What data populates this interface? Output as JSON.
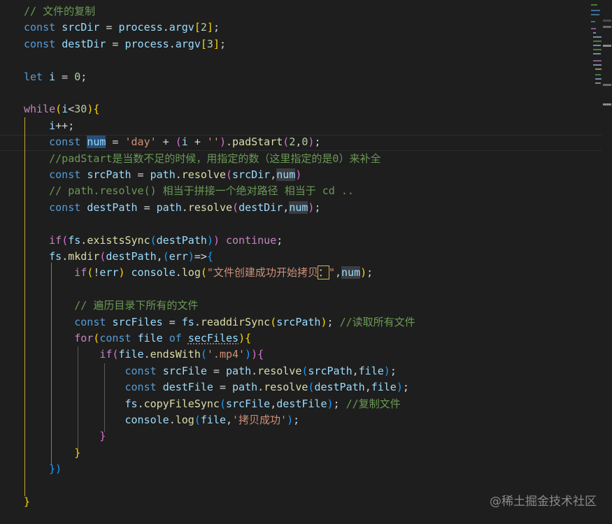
{
  "code_lines": [
    [
      [
        "// 文件的复制",
        "t-com"
      ]
    ],
    [
      [
        "const",
        "t-kw"
      ],
      [
        " ",
        ""
      ],
      [
        "srcDir",
        "t-var"
      ],
      [
        " = ",
        ""
      ],
      [
        "process",
        "t-var"
      ],
      [
        ".",
        ""
      ],
      [
        "argv",
        "t-var"
      ],
      [
        "[",
        "t-br1"
      ],
      [
        "2",
        "t-num"
      ],
      [
        "]",
        "t-br1"
      ],
      [
        ";",
        ""
      ]
    ],
    [
      [
        "const",
        "t-kw"
      ],
      [
        " ",
        ""
      ],
      [
        "destDir",
        "t-var"
      ],
      [
        " = ",
        ""
      ],
      [
        "process",
        "t-var"
      ],
      [
        ".",
        ""
      ],
      [
        "argv",
        "t-var"
      ],
      [
        "[",
        "t-br1"
      ],
      [
        "3",
        "t-num"
      ],
      [
        "]",
        "t-br1"
      ],
      [
        ";",
        ""
      ]
    ],
    [],
    [
      [
        "let",
        "t-kw"
      ],
      [
        " ",
        ""
      ],
      [
        "i",
        "t-var"
      ],
      [
        " = ",
        ""
      ],
      [
        "0",
        "t-num"
      ],
      [
        ";",
        ""
      ]
    ],
    [],
    [
      [
        "while",
        "t-ctl"
      ],
      [
        "(",
        "t-br1"
      ],
      [
        "i",
        "t-var"
      ],
      [
        "<",
        ""
      ],
      [
        "30",
        "t-num"
      ],
      [
        ")",
        "t-br1"
      ],
      [
        "{",
        "t-br1"
      ]
    ],
    [
      [
        "    ",
        ""
      ],
      [
        "i",
        "t-var"
      ],
      [
        "++;",
        ""
      ]
    ],
    [
      [
        "    ",
        ""
      ],
      [
        "const",
        "t-kw"
      ],
      [
        " ",
        ""
      ],
      [
        "num",
        "t-hl"
      ],
      [
        " = ",
        ""
      ],
      [
        "'day'",
        "t-str"
      ],
      [
        " + ",
        ""
      ],
      [
        "(",
        "t-br2"
      ],
      [
        "i",
        "t-var"
      ],
      [
        " + ",
        ""
      ],
      [
        "''",
        "t-str"
      ],
      [
        ")",
        "t-br2"
      ],
      [
        ".",
        ""
      ],
      [
        "padStart",
        "t-fn"
      ],
      [
        "(",
        "t-br2"
      ],
      [
        "2",
        "t-num"
      ],
      [
        ",",
        ""
      ],
      [
        "0",
        "t-num"
      ],
      [
        ")",
        "t-br2"
      ],
      [
        ";",
        ""
      ]
    ],
    [
      [
        "    ",
        ""
      ],
      [
        "//padStart是当数不足的时候，用指定的数（这里指定的是0）来补全",
        "t-com"
      ]
    ],
    [
      [
        "    ",
        ""
      ],
      [
        "const",
        "t-kw"
      ],
      [
        " ",
        ""
      ],
      [
        "srcPath",
        "t-var"
      ],
      [
        " = ",
        ""
      ],
      [
        "path",
        "t-var"
      ],
      [
        ".",
        ""
      ],
      [
        "resolve",
        "t-fn"
      ],
      [
        "(",
        "t-br2"
      ],
      [
        "srcDir",
        "t-var"
      ],
      [
        ",",
        ""
      ],
      [
        "num",
        "t-hl2"
      ],
      [
        ")",
        "t-br2"
      ]
    ],
    [
      [
        "    ",
        ""
      ],
      [
        "// path.resolve() 相当于拼接一个绝对路径 相当于 cd ..",
        "t-com"
      ]
    ],
    [
      [
        "    ",
        ""
      ],
      [
        "const",
        "t-kw"
      ],
      [
        " ",
        ""
      ],
      [
        "destPath",
        "t-var"
      ],
      [
        " = ",
        ""
      ],
      [
        "path",
        "t-var"
      ],
      [
        ".",
        ""
      ],
      [
        "resolve",
        "t-fn"
      ],
      [
        "(",
        "t-br2"
      ],
      [
        "destDir",
        "t-var"
      ],
      [
        ",",
        ""
      ],
      [
        "num",
        "t-hl2"
      ],
      [
        ")",
        "t-br2"
      ],
      [
        ";",
        ""
      ]
    ],
    [],
    [
      [
        "    ",
        ""
      ],
      [
        "if",
        "t-ctl"
      ],
      [
        "(",
        "t-br2"
      ],
      [
        "fs",
        "t-var"
      ],
      [
        ".",
        ""
      ],
      [
        "existsSync",
        "t-fn"
      ],
      [
        "(",
        "t-br3"
      ],
      [
        "destPath",
        "t-var"
      ],
      [
        ")",
        "t-br3"
      ],
      [
        ")",
        "t-br2"
      ],
      [
        " ",
        ""
      ],
      [
        "continue",
        "t-ctl"
      ],
      [
        ";",
        ""
      ]
    ],
    [
      [
        "    ",
        ""
      ],
      [
        "fs",
        "t-var"
      ],
      [
        ".",
        ""
      ],
      [
        "mkdir",
        "t-fn"
      ],
      [
        "(",
        "t-br2"
      ],
      [
        "destPath",
        "t-var"
      ],
      [
        ",",
        ""
      ],
      [
        "(",
        "t-br3"
      ],
      [
        "err",
        "t-var"
      ],
      [
        ")",
        "t-br3"
      ],
      [
        "=>",
        ""
      ],
      [
        "{",
        "t-br3"
      ]
    ],
    [
      [
        "        ",
        ""
      ],
      [
        "if",
        "t-ctl"
      ],
      [
        "(",
        "t-br1"
      ],
      [
        "!",
        ""
      ],
      [
        "err",
        "t-var"
      ],
      [
        ")",
        "t-br1"
      ],
      [
        " ",
        ""
      ],
      [
        "console",
        "t-var"
      ],
      [
        ".",
        ""
      ],
      [
        "log",
        "t-fn"
      ],
      [
        "(",
        "t-br1"
      ],
      [
        "\"文件创建成功开始拷贝",
        "t-str"
      ],
      [
        "：",
        "t-box"
      ],
      [
        "\"",
        "t-str"
      ],
      [
        ",",
        ""
      ],
      [
        "num",
        "t-hl2"
      ],
      [
        ")",
        "t-br1"
      ],
      [
        ";",
        ""
      ]
    ],
    [],
    [
      [
        "        ",
        ""
      ],
      [
        "// 遍历目录下所有的文件",
        "t-com"
      ]
    ],
    [
      [
        "        ",
        ""
      ],
      [
        "const",
        "t-kw"
      ],
      [
        " ",
        ""
      ],
      [
        "srcFiles",
        "t-var"
      ],
      [
        " = ",
        ""
      ],
      [
        "fs",
        "t-var"
      ],
      [
        ".",
        ""
      ],
      [
        "readdirSync",
        "t-fn"
      ],
      [
        "(",
        "t-br1"
      ],
      [
        "srcPath",
        "t-var"
      ],
      [
        ")",
        "t-br1"
      ],
      [
        "; ",
        ""
      ],
      [
        "//读取所有文件",
        "t-com"
      ]
    ],
    [
      [
        "        ",
        ""
      ],
      [
        "for",
        "t-ctl"
      ],
      [
        "(",
        "t-br1"
      ],
      [
        "const",
        "t-kw"
      ],
      [
        " ",
        ""
      ],
      [
        "file",
        "t-var"
      ],
      [
        " ",
        ""
      ],
      [
        "of",
        "t-kw"
      ],
      [
        " ",
        ""
      ],
      [
        "secFiles",
        "t-var t-wavy"
      ],
      [
        ")",
        "t-br1"
      ],
      [
        "{",
        "t-br1"
      ]
    ],
    [
      [
        "            ",
        ""
      ],
      [
        "if",
        "t-ctl"
      ],
      [
        "(",
        "t-br2"
      ],
      [
        "file",
        "t-var"
      ],
      [
        ".",
        ""
      ],
      [
        "endsWith",
        "t-fn"
      ],
      [
        "(",
        "t-br3"
      ],
      [
        "'.mp4'",
        "t-str"
      ],
      [
        ")",
        "t-br3"
      ],
      [
        ")",
        "t-br2"
      ],
      [
        "{",
        "t-br2"
      ]
    ],
    [
      [
        "                ",
        ""
      ],
      [
        "const",
        "t-kw"
      ],
      [
        " ",
        ""
      ],
      [
        "srcFile",
        "t-var"
      ],
      [
        " = ",
        ""
      ],
      [
        "path",
        "t-var"
      ],
      [
        ".",
        ""
      ],
      [
        "resolve",
        "t-fn"
      ],
      [
        "(",
        "t-br3"
      ],
      [
        "srcPath",
        "t-var"
      ],
      [
        ",",
        ""
      ],
      [
        "file",
        "t-var"
      ],
      [
        ")",
        "t-br3"
      ],
      [
        ";",
        ""
      ]
    ],
    [
      [
        "                ",
        ""
      ],
      [
        "const",
        "t-kw"
      ],
      [
        " ",
        ""
      ],
      [
        "destFile",
        "t-var"
      ],
      [
        " = ",
        ""
      ],
      [
        "path",
        "t-var"
      ],
      [
        ".",
        ""
      ],
      [
        "resolve",
        "t-fn"
      ],
      [
        "(",
        "t-br3"
      ],
      [
        "destPath",
        "t-var"
      ],
      [
        ",",
        ""
      ],
      [
        "file",
        "t-var"
      ],
      [
        ")",
        "t-br3"
      ],
      [
        ";",
        ""
      ]
    ],
    [
      [
        "                ",
        ""
      ],
      [
        "fs",
        "t-var"
      ],
      [
        ".",
        ""
      ],
      [
        "copyFileSync",
        "t-fn"
      ],
      [
        "(",
        "t-br3"
      ],
      [
        "srcFile",
        "t-var"
      ],
      [
        ",",
        ""
      ],
      [
        "destFile",
        "t-var"
      ],
      [
        ")",
        "t-br3"
      ],
      [
        "; ",
        ""
      ],
      [
        "//复制文件",
        "t-com"
      ]
    ],
    [
      [
        "                ",
        ""
      ],
      [
        "console",
        "t-var"
      ],
      [
        ".",
        ""
      ],
      [
        "log",
        "t-fn"
      ],
      [
        "(",
        "t-br3"
      ],
      [
        "file",
        "t-var"
      ],
      [
        ",",
        ""
      ],
      [
        "'拷贝成功'",
        "t-str"
      ],
      [
        ")",
        "t-br3"
      ],
      [
        ";",
        ""
      ]
    ],
    [
      [
        "            ",
        ""
      ],
      [
        "}",
        "t-br2"
      ]
    ],
    [
      [
        "        ",
        ""
      ],
      [
        "}",
        "t-br1"
      ]
    ],
    [
      [
        "    ",
        ""
      ],
      [
        "})",
        "t-br3"
      ]
    ],
    [],
    [
      [
        "}",
        "t-br1"
      ]
    ]
  ],
  "watermark": "@稀土掘金技术社区",
  "colors": {
    "background": "#1e1e1e",
    "keyword": "#569cd6",
    "control": "#c586c0",
    "variable": "#9cdcfe",
    "function": "#dcdcaa",
    "string": "#ce9178",
    "number": "#b5cea8",
    "comment": "#6a9955",
    "bracket_1": "#ffd700",
    "bracket_2": "#da70d6",
    "bracket_3": "#179fff",
    "selection_highlight": "#264f78"
  }
}
